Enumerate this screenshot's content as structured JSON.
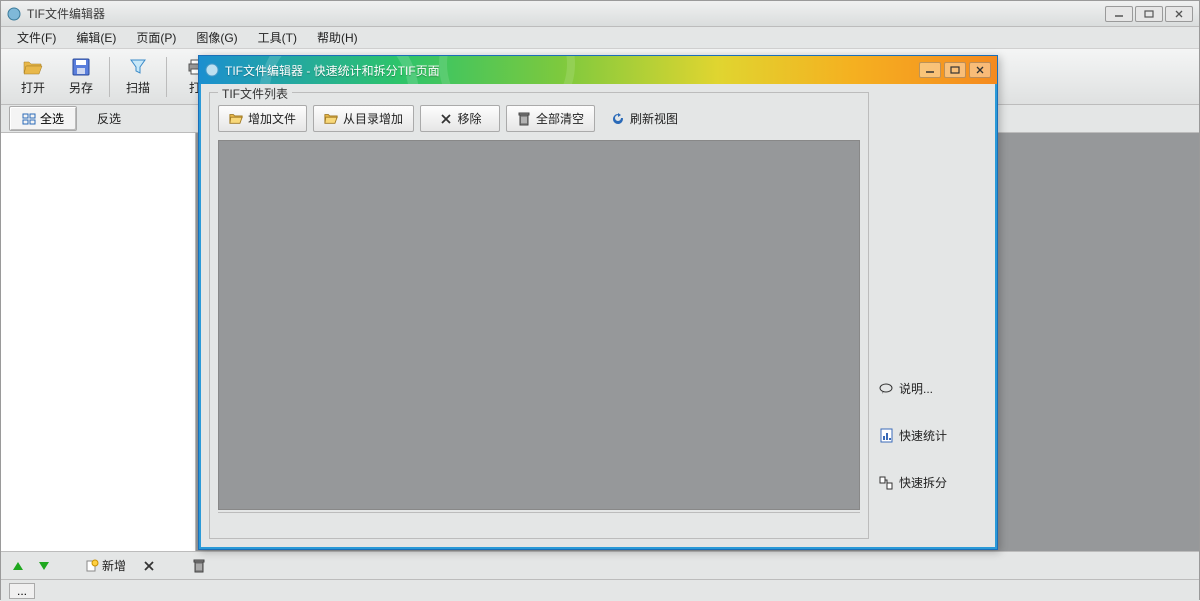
{
  "main": {
    "title": "TIF文件编辑器",
    "menubar": [
      "文件(F)",
      "编辑(E)",
      "页面(P)",
      "图像(G)",
      "工具(T)",
      "帮助(H)"
    ],
    "toolbar": [
      {
        "label": "打开",
        "icon": "folder-open-icon"
      },
      {
        "label": "另存",
        "icon": "save-icon"
      },
      {
        "label": "扫描",
        "icon": "funnel-icon"
      },
      {
        "label": "打",
        "icon": "printer-icon"
      }
    ],
    "selbar": {
      "select_all": "全选",
      "invert": "反选"
    },
    "bottombar": {
      "new_label": "新增"
    },
    "statusbar": {
      "dots": "..."
    }
  },
  "dialog": {
    "title": "TIF文件编辑器 - 快速统计和拆分TIF页面",
    "fieldset_legend": "TIF文件列表",
    "toolbar": {
      "add_file": "增加文件",
      "add_folder": "从目录增加",
      "remove": "移除",
      "clear_all": "全部清空",
      "refresh": "刷新视图"
    },
    "side": {
      "help": "说明...",
      "quick_stat": "快速统计",
      "quick_split": "快速拆分"
    }
  }
}
